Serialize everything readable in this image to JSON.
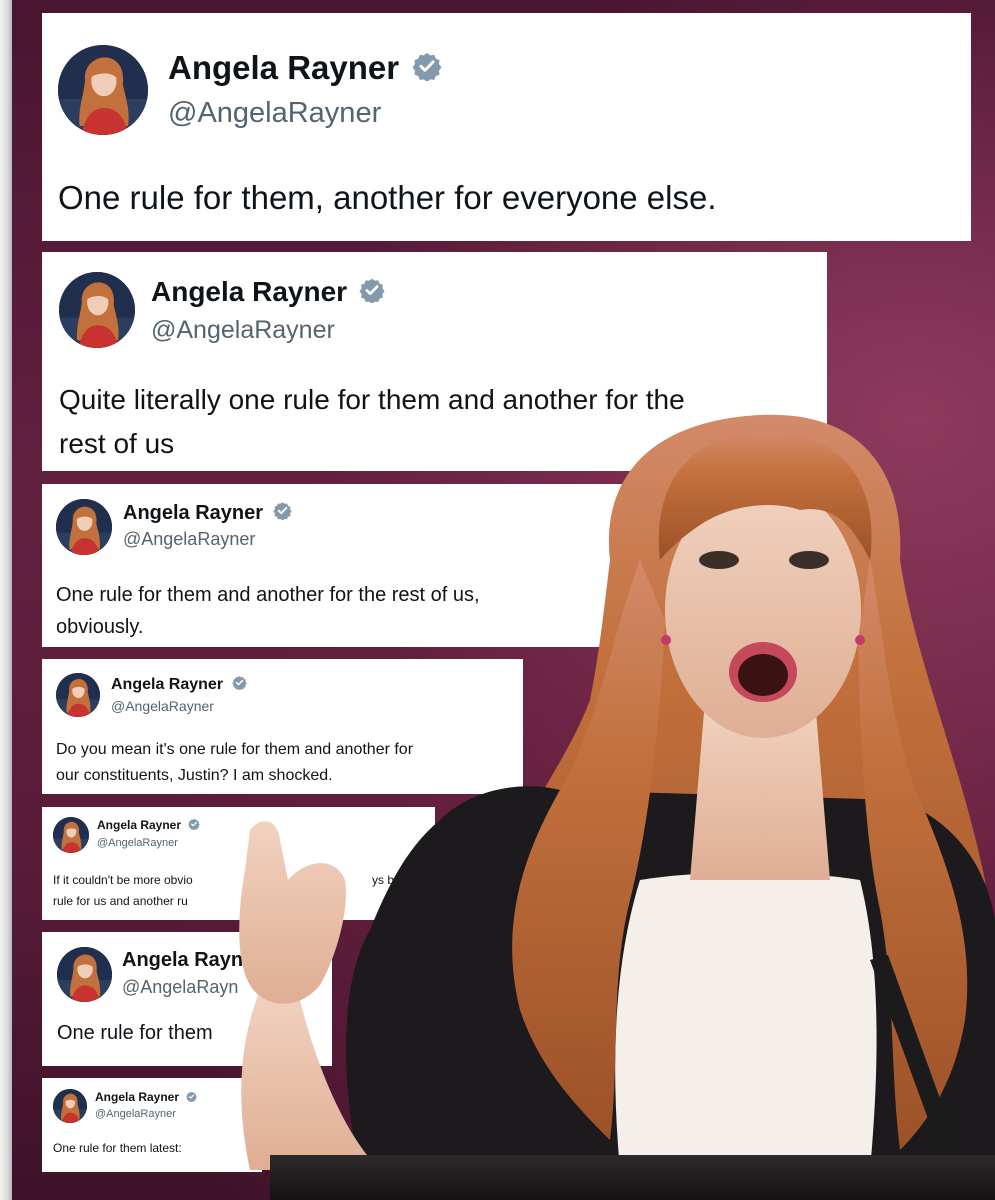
{
  "tweets": [
    {
      "name": "Angela Rayner",
      "handle": "@AngelaRayner",
      "lines": [
        "One rule for them, another for everyone else."
      ]
    },
    {
      "name": "Angela Rayner",
      "handle": "@AngelaRayner",
      "lines": [
        "Quite literally one rule for them and another for the",
        "rest of us"
      ]
    },
    {
      "name": "Angela Rayner",
      "handle": "@AngelaRayner",
      "lines": [
        "One rule for them and another for the rest of us,",
        "obviously."
      ]
    },
    {
      "name": "Angela Rayner",
      "handle": "@AngelaRayner",
      "lines": [
        "Do you mean it's one rule for them and another for",
        "our constituents, Justin? I am shocked."
      ]
    },
    {
      "name": "Angela Rayner",
      "handle": "@AngelaRayner",
      "lines": [
        "If it couldn't be more obvio",
        "rule for us and another ru"
      ],
      "trailing_fragment": "ys be"
    },
    {
      "name": "Angela Rayn",
      "handle": "@AngelaRayn",
      "lines": [
        "One rule for them"
      ]
    },
    {
      "name": "Angela Rayner",
      "handle": "@AngelaRayner",
      "lines": [
        "One rule for them latest:"
      ]
    }
  ],
  "colors": {
    "background": "#5e1a38",
    "card": "#ffffff",
    "verified_badge": "#829aab",
    "handle": "#536471",
    "hair": "#c2703c"
  },
  "icons": {
    "badge": "verified-badge-icon",
    "avatar": "profile-avatar"
  }
}
